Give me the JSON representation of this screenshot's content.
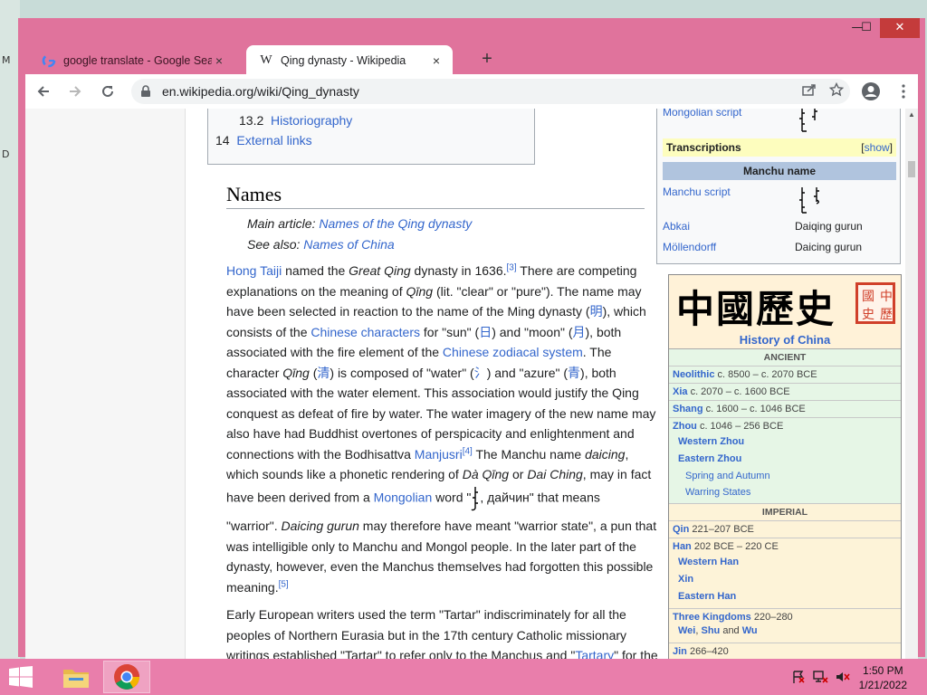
{
  "desktop": {
    "left_labels": [
      "M",
      "D"
    ]
  },
  "window": {
    "minimize": "—",
    "maximize": "☐",
    "close": "✕"
  },
  "tabs": [
    {
      "title": "google translate - Google Search",
      "close": "×",
      "favicon": "google-icon"
    },
    {
      "title": "Qing dynasty - Wikipedia",
      "close": "×",
      "favicon": "W"
    }
  ],
  "new_tab": "+",
  "toolbar": {
    "url": "en.wikipedia.org/wiki/Qing_dynasty"
  },
  "toc": {
    "items": [
      {
        "num": "13.2",
        "label": "Historiography"
      },
      {
        "num": "14",
        "label": "External links"
      }
    ]
  },
  "article": {
    "heading": "Names",
    "main_prefix": "Main article: ",
    "main_link": "Names of the Qing dynasty",
    "also_prefix": "See also: ",
    "also_link": "Names of China",
    "p1": {
      "hong_taiji": "Hong Taiji",
      "t1": " named the ",
      "great_qing": "Great Qing",
      "t2": " dynasty in 1636.",
      "ref3": "[3]",
      "t3": " There are competing explanations on the meaning of ",
      "qing1": "Qīng",
      "t4": " (lit. \"clear\" or \"pure\"). The name may have been selected in reaction to the name of the Ming dynasty (",
      "ming": "明",
      "t5": "), which consists of the ",
      "chinese_chars": "Chinese characters",
      "t6": " for \"sun\" (",
      "ri": "日",
      "t7": ") and \"moon\" (",
      "yue": "月",
      "t8": "), both associated with the fire element of the ",
      "zodiac": "Chinese zodiacal system",
      "t9": ". The character ",
      "qing2": "Qīng",
      "t10": " (",
      "qing_char": "清",
      "t11": ") is composed of \"water\" (",
      "water": "氵",
      "t12": ") and \"azure\" (",
      "azure": "青",
      "t13": "), both associated with the water element. This association would justify the Qing conquest as defeat of fire by water. The water imagery of the new name may also have had Buddhist overtones of perspicacity and enlightenment and connections with the Bodhisattva ",
      "manjusri": "Manjusri",
      "ref4": "[4]",
      "t14": " The Manchu name ",
      "daicing": "daicing",
      "t15": ", which sounds like a phonetic rendering of ",
      "daqing": "Dà Qīng",
      "t16": " or ",
      "daiching": "Dai Ching",
      "t17": ", may in fact have been derived from a ",
      "mongolian": "Mongolian",
      "t18": " word \"",
      "t19": ", дайчин\" that means",
      "t20": "\"warrior\". ",
      "daicing_gurun": "Daicing gurun",
      "t21": " may therefore have meant \"warrior state\", a pun that was intelligible only to Manchu and Mongol people. In the later part of the dynasty, however, even the Manchus themselves had forgotten this possible meaning.",
      "ref5": "[5]"
    },
    "p2": {
      "t1": "Early European writers used the term \"Tartar\" indiscriminately for all the peoples of Northern Eurasia but in the 17th century Catholic missionary writings established \"Tartar\" to refer only to the Manchus and \"",
      "tartary": "Tartary",
      "t2": "\" for the"
    }
  },
  "infobox": {
    "mongolian_script": "Mongolian script",
    "transcriptions": "Transcriptions",
    "show": "show",
    "manchu_name": "Manchu name",
    "manchu_script": "Manchu script",
    "abkai": "Abkai",
    "abkai_val": "Daiqing gurun",
    "mollendorff": "Möllendorff",
    "mollendorff_val": "Daicing gurun"
  },
  "history_box": {
    "chars": "中國歷史",
    "seal": [
      "中",
      "國",
      "歷",
      "史"
    ],
    "title": "History of China",
    "ancient": "ANCIENT",
    "imperial": "IMPERIAL",
    "entries": {
      "neolithic": {
        "name": "Neolithic",
        "dates": " c. 8500 – c. 2070 BCE"
      },
      "xia": {
        "name": "Xia",
        "dates": " c. 2070 – c. 1600 BCE"
      },
      "shang": {
        "name": "Shang",
        "dates": " c. 1600 – c. 1046 BCE"
      },
      "zhou": {
        "name": "Zhou",
        "dates": " c. 1046 – 256 BCE"
      },
      "qin": {
        "name": "Qin",
        "dates": " 221–207 BCE"
      },
      "han": {
        "name": "Han",
        "dates": " 202 BCE – 220 CE"
      },
      "three_kingdoms": {
        "name": "Three Kingdoms",
        "dates": " 220–280"
      },
      "jin": {
        "name": "Jin",
        "dates": " 266–420"
      }
    },
    "zhou_subs": [
      "Western Zhou",
      "Eastern Zhou"
    ],
    "zhou_subs2": [
      "Spring and Autumn",
      "Warring States"
    ],
    "han_subs": [
      "Western Han",
      "Xin",
      "Eastern Han"
    ],
    "three_subs": {
      "wei": "Wei",
      "comma": ", ",
      "shu": "Shu",
      "and": " and ",
      "wu": "Wu"
    }
  },
  "taskbar": {
    "time": "1:50 PM",
    "date": "1/21/2022"
  }
}
